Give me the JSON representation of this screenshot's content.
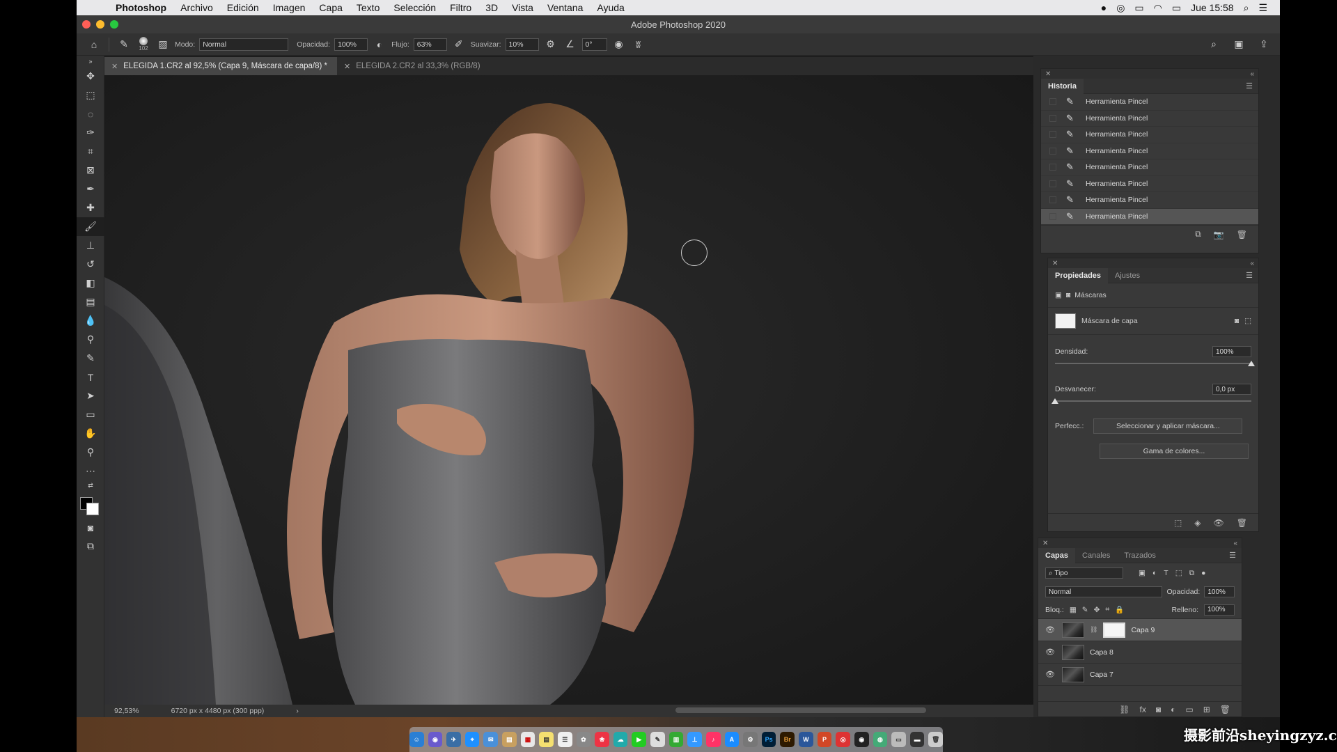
{
  "menubar": {
    "app_name": "Photoshop",
    "items": [
      "Archivo",
      "Edición",
      "Imagen",
      "Capa",
      "Texto",
      "Selección",
      "Filtro",
      "3D",
      "Vista",
      "Ventana",
      "Ayuda"
    ],
    "clock": "Jue 15:58"
  },
  "window": {
    "title": "Adobe Photoshop 2020"
  },
  "options": {
    "brush_size": "102",
    "mode_label": "Modo:",
    "mode_value": "Normal",
    "opacity_label": "Opacidad:",
    "opacity_value": "100%",
    "flow_label": "Flujo:",
    "flow_value": "63%",
    "smooth_label": "Suavizar:",
    "smooth_value": "10%",
    "angle_value": "0°"
  },
  "tabs": [
    {
      "label": "ELEGIDA 1.CR2 al 92,5% (Capa 9, Máscara de capa/8) *"
    },
    {
      "label": "ELEGIDA 2.CR2 al 33,3% (RGB/8)"
    }
  ],
  "status": {
    "zoom": "92,53%",
    "doc_info": "6720 px x 4480 px (300 ppp)"
  },
  "history": {
    "title": "Historia",
    "items": [
      "Herramienta Pincel",
      "Herramienta Pincel",
      "Herramienta Pincel",
      "Herramienta Pincel",
      "Herramienta Pincel",
      "Herramienta Pincel",
      "Herramienta Pincel",
      "Herramienta Pincel"
    ],
    "selected_index": 7
  },
  "properties": {
    "tab_active": "Propiedades",
    "tab_other": "Ajustes",
    "section_label": "Máscaras",
    "mask_label": "Máscara de capa",
    "density_label": "Densidad:",
    "density_value": "100%",
    "density_level": 1.0,
    "feather_label": "Desvanecer:",
    "feather_value": "0,0 px",
    "feather_level": 0.0,
    "refine_label": "Perfecc.:",
    "select_mask_button": "Seleccionar y aplicar máscara...",
    "color_range_button": "Gama de colores..."
  },
  "layers": {
    "tab_active": "Capas",
    "tab_channels": "Canales",
    "tab_paths": "Trazados",
    "filter_label": "Tipo",
    "blend_mode": "Normal",
    "opacity_label": "Opacidad:",
    "opacity_value": "100%",
    "lock_label": "Bloq.:",
    "fill_label": "Relleno:",
    "fill_value": "100%",
    "items": [
      {
        "name": "Capa 9",
        "has_mask": true,
        "selected": true
      },
      {
        "name": "Capa 8",
        "has_mask": false,
        "selected": false
      },
      {
        "name": "Capa 7",
        "has_mask": false,
        "selected": false
      }
    ]
  },
  "watermark": "摄影前沿sheyingzyz.com"
}
